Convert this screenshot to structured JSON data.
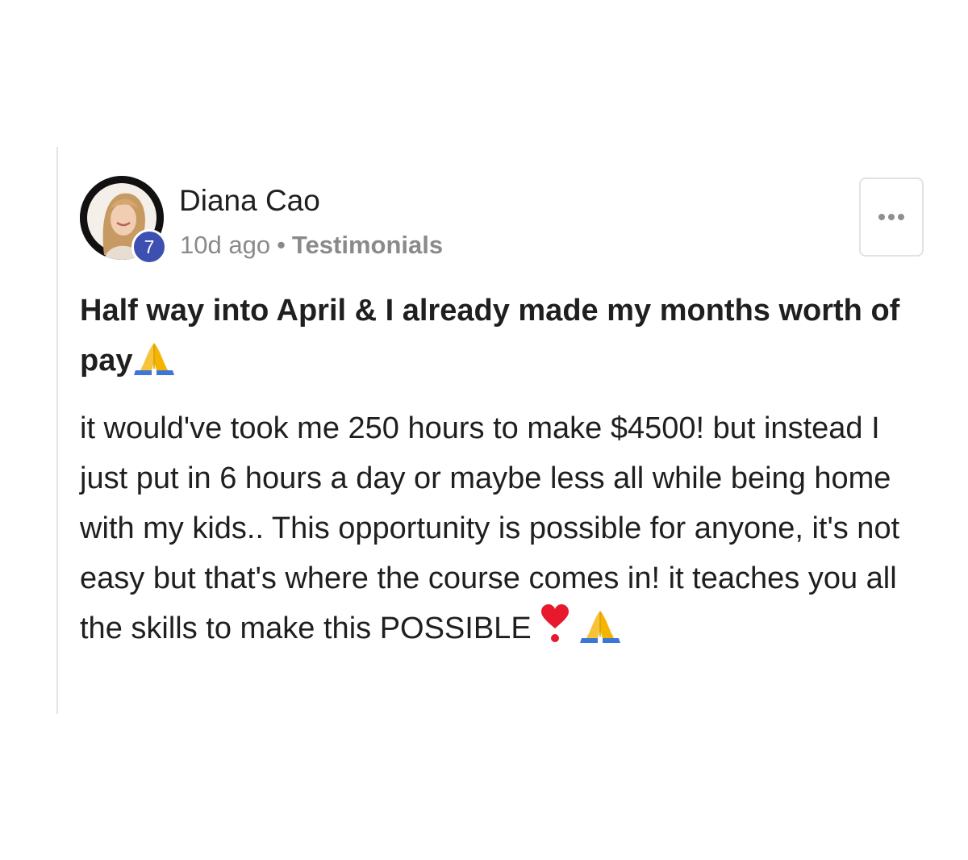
{
  "post": {
    "author": {
      "name": "Diana Cao",
      "level": "7"
    },
    "meta": {
      "time_ago": "10d ago",
      "separator": "•",
      "category": "Testimonials"
    },
    "title": "Half way into April & I already made my months worth of pay",
    "title_emoji": "folded-hands-icon",
    "body": "it would've took me 250 hours to make $4500! but instead I just put in 6 hours a day or maybe less all while being home with my kids.. This opportunity is possible for anyone, it's not easy but that's where the course comes in! it teaches you all the skills to make this POSSIBLE",
    "body_emojis": [
      "heavy-heart-exclamation-icon",
      "folded-hands-icon"
    ],
    "more_button_icon": "more-horizontal-icon"
  },
  "colors": {
    "level_badge": "#3d4fb0",
    "meta_text": "#8a8a8a",
    "text": "#1f1f1f",
    "heart": "#e8192c",
    "hands": "#f7c339",
    "sleeve": "#3c76d6"
  }
}
